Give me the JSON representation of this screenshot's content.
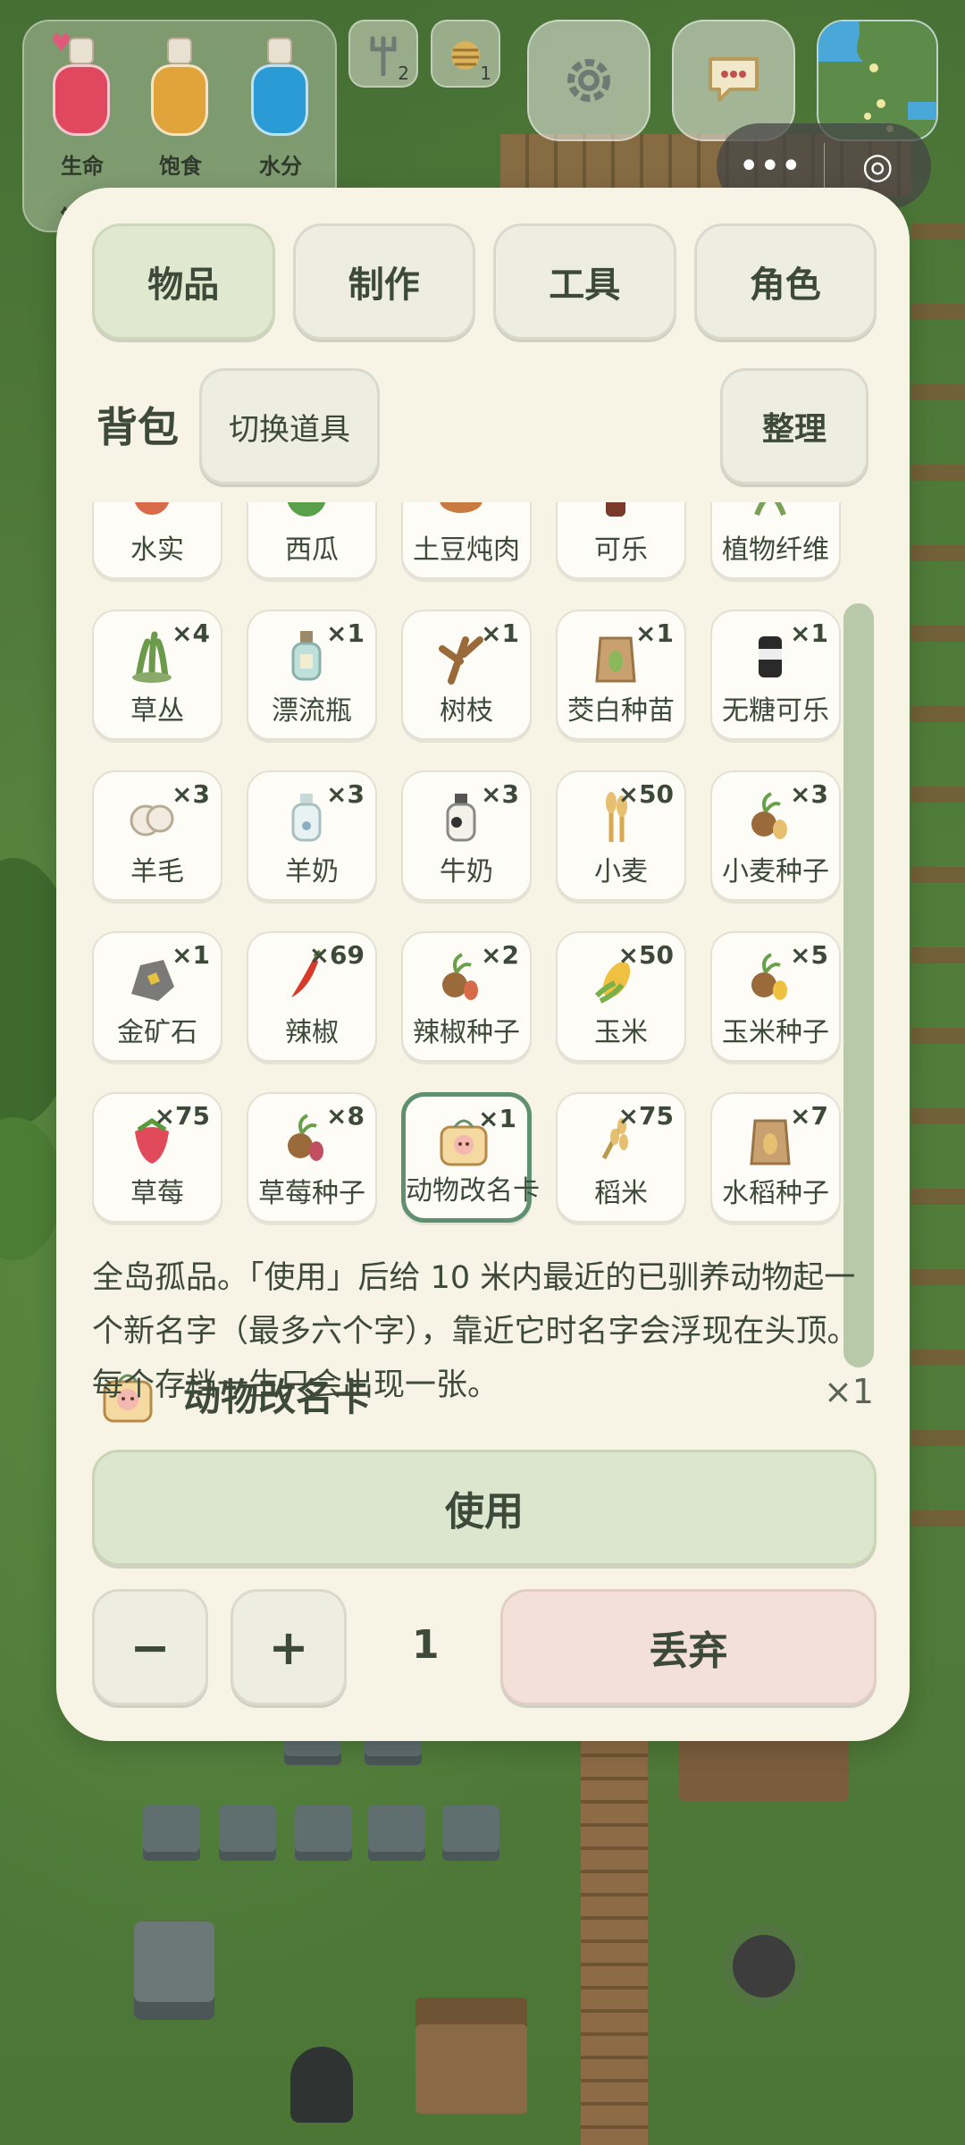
{
  "hud": {
    "stats": [
      {
        "label": "生命",
        "color": "#e0485f"
      },
      {
        "label": "饱食",
        "color": "#e0a43a"
      },
      {
        "label": "水分",
        "color": "#2b9bd6"
      }
    ],
    "stats_extra": "第",
    "slots": [
      {
        "icon": "trident-icon",
        "count": "2"
      },
      {
        "icon": "beehive-icon",
        "count": "1"
      }
    ],
    "settings_icon": "gear-icon",
    "chat_icon": "chat-bubble-icon",
    "minimap_icon": "minimap-icon"
  },
  "capsule": {
    "more": "•••",
    "close": "◎"
  },
  "tabs": [
    {
      "label": "物品",
      "active": true
    },
    {
      "label": "制作",
      "active": false
    },
    {
      "label": "工具",
      "active": false
    },
    {
      "label": "角色",
      "active": false
    }
  ],
  "bag": {
    "title": "背包",
    "switch_label": "切换道具",
    "sort_label": "整理"
  },
  "items": [
    {
      "name": "水实",
      "qty": "",
      "icon": "fruit-icon"
    },
    {
      "name": "西瓜",
      "qty": "",
      "icon": "watermelon-icon"
    },
    {
      "name": "土豆炖肉",
      "qty": "",
      "icon": "stew-icon"
    },
    {
      "name": "可乐",
      "qty": "",
      "icon": "cola-icon"
    },
    {
      "name": "植物纤维",
      "qty": "",
      "icon": "fiber-icon"
    },
    {
      "name": "草丛",
      "qty": "×4",
      "icon": "grass-icon"
    },
    {
      "name": "漂流瓶",
      "qty": "×1",
      "icon": "bottle-icon"
    },
    {
      "name": "树枝",
      "qty": "×1",
      "icon": "branch-icon"
    },
    {
      "name": "茭白种苗",
      "qty": "×1",
      "icon": "seed-bag-icon"
    },
    {
      "name": "无糖可乐",
      "qty": "×1",
      "icon": "can-icon"
    },
    {
      "name": "羊毛",
      "qty": "×3",
      "icon": "wool-icon"
    },
    {
      "name": "羊奶",
      "qty": "×3",
      "icon": "milk-bottle-icon"
    },
    {
      "name": "牛奶",
      "qty": "×3",
      "icon": "cow-milk-icon"
    },
    {
      "name": "小麦",
      "qty": "×50",
      "icon": "wheat-icon"
    },
    {
      "name": "小麦种子",
      "qty": "×3",
      "icon": "wheat-seed-icon"
    },
    {
      "name": "金矿石",
      "qty": "×1",
      "icon": "gold-ore-icon"
    },
    {
      "name": "辣椒",
      "qty": "×69",
      "icon": "chili-icon"
    },
    {
      "name": "辣椒种子",
      "qty": "×2",
      "icon": "chili-seed-icon"
    },
    {
      "name": "玉米",
      "qty": "×50",
      "icon": "corn-icon"
    },
    {
      "name": "玉米种子",
      "qty": "×5",
      "icon": "corn-seed-icon"
    },
    {
      "name": "草莓",
      "qty": "×75",
      "icon": "strawberry-icon"
    },
    {
      "name": "草莓种子",
      "qty": "×8",
      "icon": "strawberry-seed-icon"
    },
    {
      "name": "动物改名卡",
      "qty": "×1",
      "icon": "rename-card-icon",
      "selected": true
    },
    {
      "name": "稻米",
      "qty": "×75",
      "icon": "rice-icon"
    },
    {
      "name": "水稻种子",
      "qty": "×7",
      "icon": "rice-seed-bag-icon"
    }
  ],
  "detail": {
    "name": "动物改名卡",
    "qty": "×1",
    "description": "全岛孤品。「使用」后给 10 米内最近的已驯养动物起一个新名字（最多六个字），靠近它时名字会浮现在头顶。每个存档一生只会出现一张。",
    "use_label": "使用",
    "minus_label": "−",
    "plus_label": "+",
    "count": "1",
    "drop_label": "丢弃"
  }
}
